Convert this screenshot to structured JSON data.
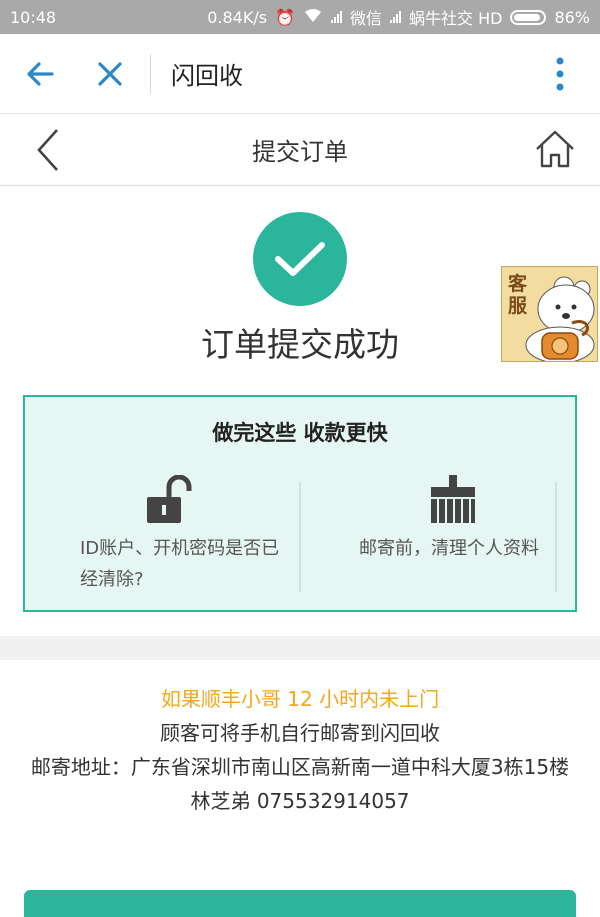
{
  "status_bar": {
    "time": "10:48",
    "network_speed": "0.84K/s",
    "carrier1": "微信",
    "carrier2": "蜗牛社交 HD",
    "battery": "86%"
  },
  "app_bar": {
    "title": "闪回收"
  },
  "nav_bar": {
    "title": "提交订单"
  },
  "success": {
    "text": "订单提交成功",
    "color": "#2bb59a"
  },
  "customer_service": {
    "label": "客服"
  },
  "tips": {
    "title": "做完这些 收款更快",
    "items": [
      {
        "icon": "unlock-icon",
        "text": "ID账户、开机密码是否已经清除?"
      },
      {
        "icon": "brush-icon",
        "text": "邮寄前，清理个人资料"
      }
    ]
  },
  "info": {
    "warning": "如果顺丰小哥 12 小时内未上门",
    "line2": "顾客可将手机自行邮寄到闪回收",
    "address": "邮寄地址：广东省深圳市南山区高新南一道中科大厦3栋15楼",
    "contact": "林芝弟 075532914057",
    "warning_color": "#f2a81c"
  },
  "accent_color": "#2bb59a"
}
